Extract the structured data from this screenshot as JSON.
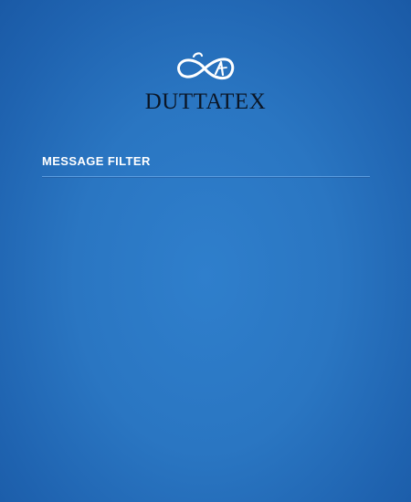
{
  "brand": {
    "name": "DUTTATEX",
    "logo_icon": "infinity-monogram-icon"
  },
  "panel": {
    "title": "MESSAGE FILTER"
  },
  "colors": {
    "background": "#2a76c2",
    "title_text": "#ffffff",
    "brand_text": "#0b1626",
    "divider": "#5d9ee0"
  }
}
